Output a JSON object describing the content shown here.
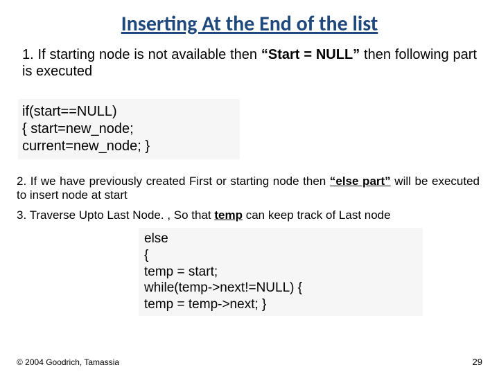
{
  "title": "Inserting At the End of the list",
  "p1_a": "1. If starting node is not available then ",
  "p1_b": "“Start = NULL”",
  "p1_c": " then following part is executed",
  "code1": "if(start==NULL)\n{ start=new_node;\ncurrent=new_node; }",
  "p2_a": "2. If we have previously created First or starting node then ",
  "p2_b": "“else part”",
  "p2_c": " will be executed to insert node at start",
  "p3_a": "3. Traverse Upto Last Node. , So that ",
  "p3_b": "temp",
  "p3_c": " can keep track of Last node",
  "code2": "else\n{\ntemp = start;\nwhile(temp->next!=NULL) {\n temp = temp->next; }",
  "footer_left": "© 2004 Goodrich, Tamassia",
  "footer_right": "29"
}
